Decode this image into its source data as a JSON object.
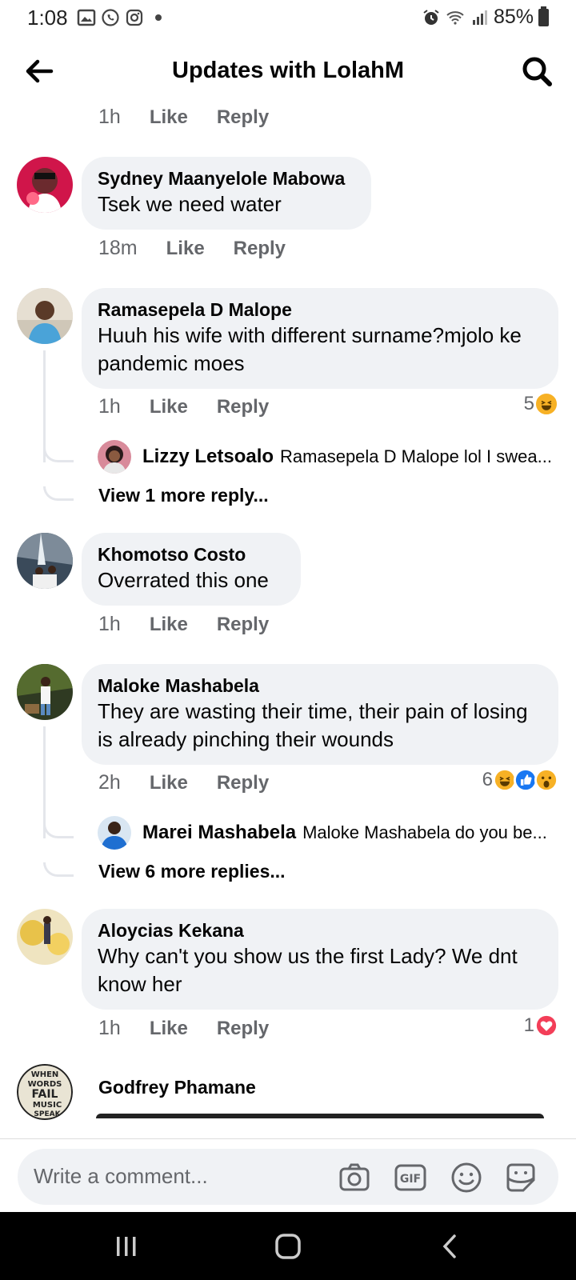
{
  "status_bar": {
    "time": "1:08",
    "battery": "85%"
  },
  "header": {
    "title": "Updates with LolahM"
  },
  "top_actions": {
    "time": "1h",
    "like": "Like",
    "reply": "Reply"
  },
  "comments": [
    {
      "name": "Sydney Maanyelole Mabowa",
      "text": "Tsek we need water",
      "time": "18m",
      "like": "Like",
      "reply": "Reply"
    },
    {
      "name": "Ramasepela D Malope",
      "text": "Huuh his wife with different surname?mjolo ke pandemic moes",
      "time": "1h",
      "like": "Like",
      "reply": "Reply",
      "reaction_count": "5",
      "reply_preview": {
        "name": "Lizzy Letsoalo",
        "text": "Ramasepela D Malope lol I swea..."
      },
      "more_replies": "View 1 more reply..."
    },
    {
      "name": "Khomotso Costo",
      "text": "Overrated this one",
      "time": "1h",
      "like": "Like",
      "reply": "Reply"
    },
    {
      "name": "Maloke Mashabela",
      "text": "They are wasting their time, their pain of losing is already pinching their wounds",
      "time": "2h",
      "like": "Like",
      "reply": "Reply",
      "reaction_count": "6",
      "reply_preview": {
        "name": "Marei Mashabela",
        "text": "Maloke Mashabela do you be..."
      },
      "more_replies": "View 6 more replies..."
    },
    {
      "name": "Aloycias Kekana",
      "text": "Why can't you show us the first Lady?  We dnt know her",
      "time": "1h",
      "like": "Like",
      "reply": "Reply",
      "reaction_count": "1"
    },
    {
      "name": "Godfrey Phamane"
    }
  ],
  "composer": {
    "placeholder": "Write a comment...",
    "gif_label": "GIF"
  },
  "avatar_logo_text": [
    "WHEN",
    "WORDS",
    "FAIL",
    "MUSIC",
    "SPEAK"
  ]
}
